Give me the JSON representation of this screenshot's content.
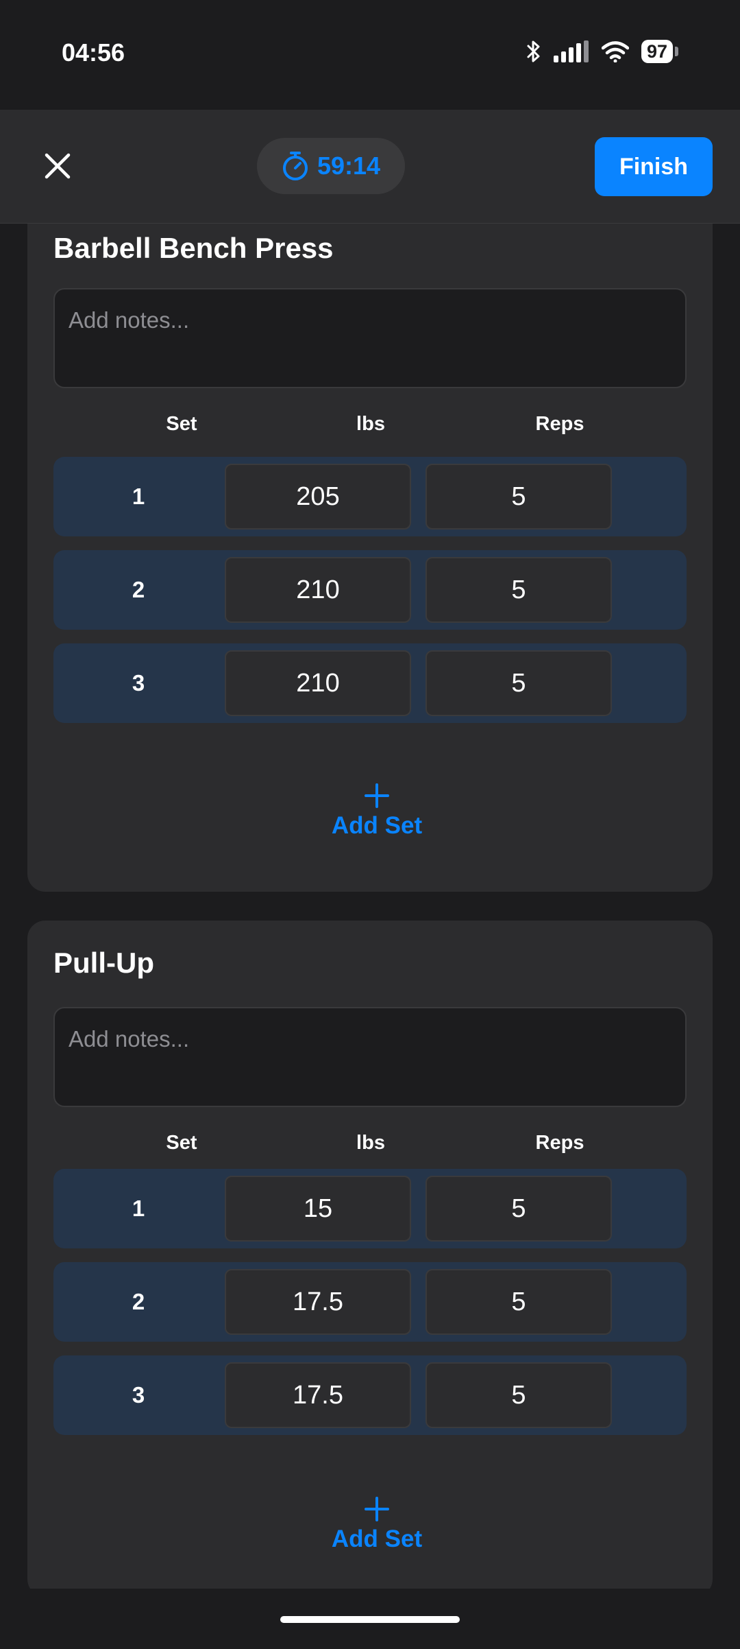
{
  "status_bar": {
    "time": "04:56",
    "battery": "97",
    "icons": [
      "bluetooth-icon",
      "signal-icon",
      "wifi-icon",
      "battery-icon"
    ]
  },
  "header": {
    "close_icon": "close-icon",
    "timer_icon": "stopwatch-icon",
    "timer": "59:14",
    "finish_label": "Finish"
  },
  "columns": {
    "set": "Set",
    "weight": "lbs",
    "reps": "Reps"
  },
  "exercises": [
    {
      "title": "Barbell Bench Press",
      "notes_placeholder": "Add notes...",
      "sets": [
        {
          "num": "1",
          "weight": "205",
          "reps": "5"
        },
        {
          "num": "2",
          "weight": "210",
          "reps": "5"
        },
        {
          "num": "3",
          "weight": "210",
          "reps": "5"
        }
      ],
      "add_set_label": "Add Set"
    },
    {
      "title": "Pull-Up",
      "notes_placeholder": "Add notes...",
      "sets": [
        {
          "num": "1",
          "weight": "15",
          "reps": "5"
        },
        {
          "num": "2",
          "weight": "17.5",
          "reps": "5"
        },
        {
          "num": "3",
          "weight": "17.5",
          "reps": "5"
        }
      ],
      "add_set_label": "Add Set"
    }
  ],
  "colors": {
    "accent": "#0a84ff",
    "background": "#1c1c1e",
    "card": "#2c2c2e",
    "set_row": "#25354a"
  }
}
